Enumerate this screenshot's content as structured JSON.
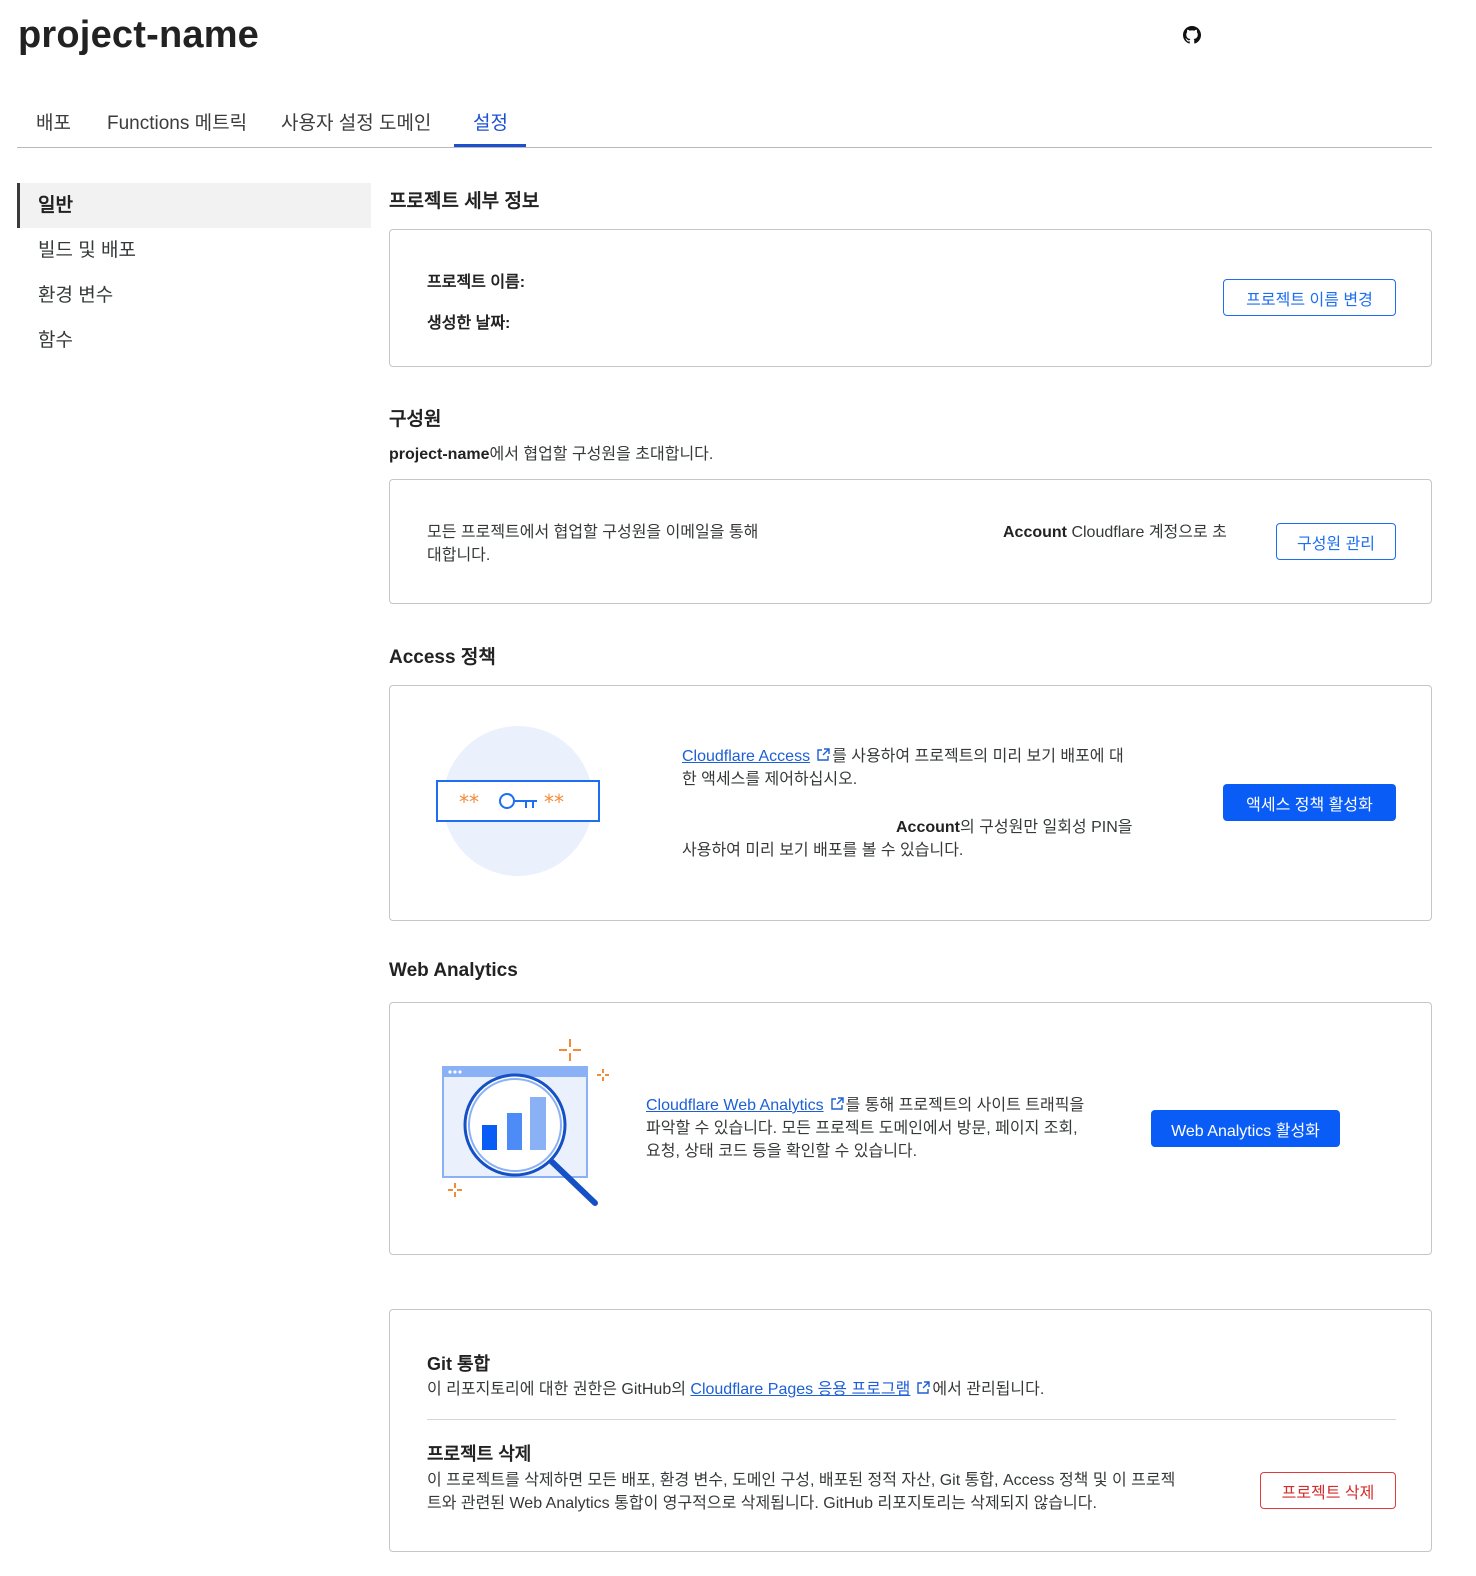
{
  "header": {
    "title": "project-name",
    "github_icon": "github-icon"
  },
  "tabs": [
    {
      "label": "배포"
    },
    {
      "label": "Functions 메트릭"
    },
    {
      "label": "사용자 설정 도메인"
    },
    {
      "label": "설정",
      "active": true
    }
  ],
  "sidebar": {
    "items": [
      {
        "label": "일반",
        "active": true
      },
      {
        "label": "빌드 및 배포"
      },
      {
        "label": "환경 변수"
      },
      {
        "label": "함수"
      }
    ]
  },
  "project_details": {
    "title": "프로젝트 세부 정보",
    "name_label": "프로젝트 이름:",
    "created_label": "생성한 날짜:",
    "rename_button": "프로젝트 이름 변경"
  },
  "members": {
    "title": "구성원",
    "desc_project": "project-name",
    "desc_rest": "에서 협업할 구성원을 초대합니다.",
    "card_text_line1": "모든 프로젝트에서 협업할 구성원을 이메일을 통해",
    "card_text_line2": "대합니다.",
    "account_bold": "Account",
    "account_rest": " Cloudflare 계정으로 초",
    "manage_button": "구성원 관리"
  },
  "access": {
    "title": "Access 정책",
    "link_text": "Cloudflare Access",
    "text_line1_rest": "를 사용하여 프로젝트의 미리 보기 배포에 대",
    "text_line2": "한 액세스를 제어하십시오.",
    "account_bold": "Account",
    "text_line3_rest": "의 구성원만 일회성 PIN을",
    "text_line4": "사용하여 미리 보기 배포를 볼 수 있습니다.",
    "enable_button": "액세스 정책 활성화",
    "illustration_text": "** O┬┬ **"
  },
  "web_analytics": {
    "title": "Web Analytics",
    "link_text": "Cloudflare Web Analytics",
    "text_line1_rest": "를 통해 프로젝트의 사이트 트래픽을",
    "text_line2": "파악할 수 있습니다. 모든 프로젝트 도메인에서 방문, 페이지 조회,",
    "text_line3": "요청, 상태 코드 등을 확인할 수 있습니다.",
    "enable_button": "Web Analytics 활성화"
  },
  "git": {
    "title": "Git 통합",
    "text_before": "이 리포지토리에 대한 권한은 GitHub의 ",
    "link_text": "Cloudflare Pages 응용 프로그램",
    "text_after": "에서 관리됩니다."
  },
  "delete": {
    "title": "프로젝트 삭제",
    "text_line1": "이 프로젝트를 삭제하면 모든 배포, 환경 변수, 도메인 구성, 배포된 정적 자산, Git 통합, Access 정책 및 이 프로젝",
    "text_line2": "트와 관련된 Web Analytics 통합이 영구적으로 삭제됩니다. GitHub 리포지토리는 삭제되지 않습니다.",
    "delete_button": "프로젝트 삭제"
  },
  "colors": {
    "accent": "#0a5cf7",
    "link": "#1d5fd6",
    "danger": "#d42d2d",
    "illustration_orange": "#f28c38"
  }
}
